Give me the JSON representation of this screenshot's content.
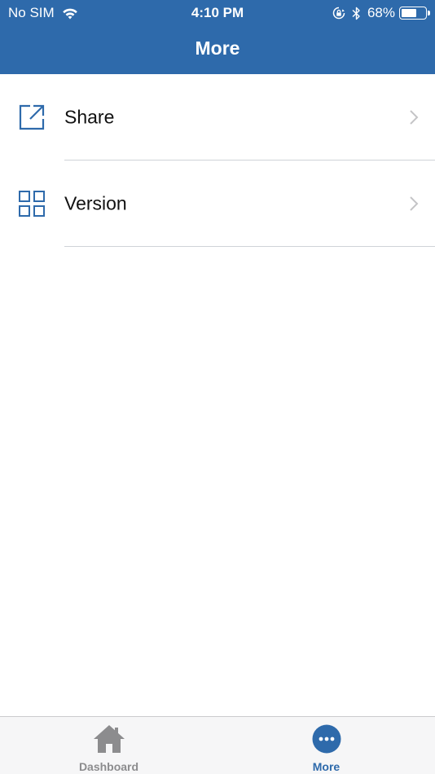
{
  "colors": {
    "header_bg": "#2e6aab",
    "accent": "#2e6aab",
    "tab_inactive": "#8c8c8e",
    "divider": "#cfd3d8"
  },
  "status_bar": {
    "carrier": "No SIM",
    "time": "4:10 PM",
    "battery_percent": "68%",
    "battery_level": 0.68,
    "icons": [
      "wifi-icon",
      "rotation-lock-icon",
      "bluetooth-icon",
      "battery-icon"
    ]
  },
  "nav": {
    "title": "More"
  },
  "menu": {
    "items": [
      {
        "label": "Share",
        "icon": "share-external-icon"
      },
      {
        "label": "Version",
        "icon": "grid-icon"
      }
    ]
  },
  "tab_bar": {
    "tabs": [
      {
        "label": "Dashboard",
        "icon": "home-icon",
        "active": false
      },
      {
        "label": "More",
        "icon": "more-dots-icon",
        "active": true
      }
    ]
  }
}
